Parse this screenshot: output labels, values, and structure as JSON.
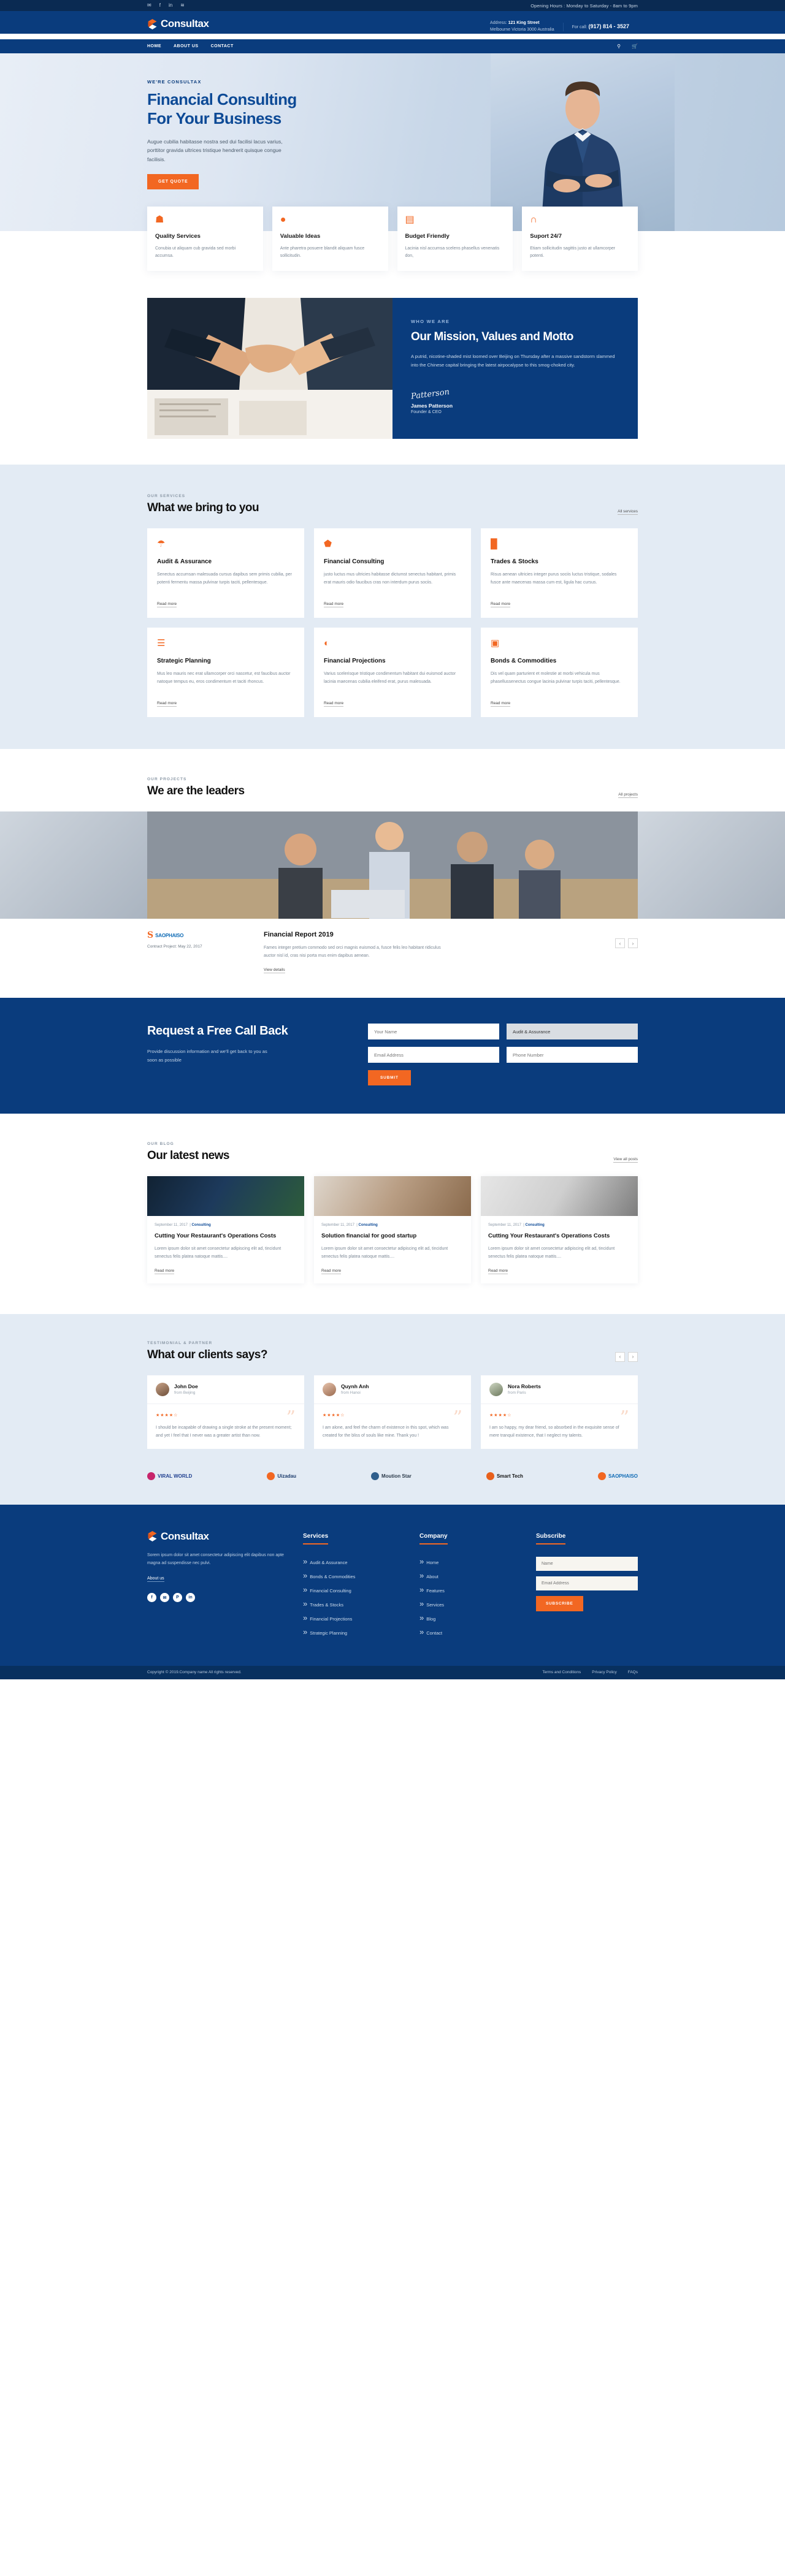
{
  "topbar": {
    "social": [
      "twitter-icon",
      "facebook-icon",
      "linkedin-icon",
      "rss-icon"
    ],
    "social_glyphs": [
      "✉",
      "f",
      "in",
      "≋"
    ],
    "opening_hours": "Opening Hours : Monday to Saturday - 8am to 9pm"
  },
  "header": {
    "brand": "Consultax",
    "address_label": "Address:",
    "address_line1": "121 King Street",
    "address_line2": "Melbourne Victoria 3000 Australia",
    "phone_label": "For call:",
    "phone": "(917) 814 - 3527"
  },
  "nav": {
    "items": [
      "HOME",
      "ABOUT US",
      "CONTACT"
    ],
    "search_icon": "search-icon",
    "cart_icon": "cart-icon"
  },
  "hero": {
    "eyebrow": "WE'RE CONSULTAX",
    "title": "Financial Consulting For Your Business",
    "desc": "Augue cubilia habitasse nostra sed dui facilisi lacus varius, porttitor gravida ultrices tristique hendrerit quisque congue facilisis.",
    "cta": "GET QUOTE"
  },
  "features": [
    {
      "icon": "medal-icon",
      "glyph": "☗",
      "title": "Quality Services",
      "desc": "Conubia ut aliquam cub gravida sed morbi accumsa."
    },
    {
      "icon": "lightbulb-icon",
      "glyph": "●",
      "title": "Valuable Ideas",
      "desc": "Ante pharetra posuere blandit aliquam fusce sollicitudin."
    },
    {
      "icon": "money-icon",
      "glyph": "▤",
      "title": "Budget Friendly",
      "desc": "Lacinia nisl accumsa scelens phasellus venenatis don,"
    },
    {
      "icon": "headset-icon",
      "glyph": "∩",
      "title": "Suport 24/7",
      "desc": "Etiam sollicitudin sagittis justo at ullamcorper potenti."
    }
  ],
  "mission": {
    "eyebrow": "WHO WE ARE",
    "title": "Our Mission, Values and Motto",
    "desc": "A putrid, nicotine-shaded mist loomed over Beijing on Thursday after a massive sandstorm slammed into the Chinese capital bringing the latest airpocalypse to this smog-choked city.",
    "signature": "Patterson",
    "name": "James Patterson",
    "role": "Founder & CEO"
  },
  "services": {
    "eyebrow": "OUR SERVICES",
    "title": "What we bring to you",
    "link": "All services",
    "readmore": "Read more",
    "items": [
      {
        "icon": "umbrella-icon",
        "glyph": "☂",
        "title": "Audit & Assurance",
        "desc": "Senectus accumsan malesuada cursus dapibus sem primis cubilia, per potenti fermentu massa pulvinar turpis taciti, pellentesque."
      },
      {
        "icon": "box-icon",
        "glyph": "⬟",
        "title": "Financial Consulting",
        "desc": "justo luctus mus ultricies habitasse dictumst senectus habitant, primis erat mauris odio faucibus cras non interdum purus sociis."
      },
      {
        "icon": "bar-chart-icon",
        "glyph": "█",
        "title": "Trades & Stocks",
        "desc": "Risus aenean ultricies integer purus sociis luctus tristique, sodales fusce ante maecenas massa cum est, ligula hac cursus."
      },
      {
        "icon": "document-icon",
        "glyph": "☰",
        "title": "Strategic Planning",
        "desc": "Mus leo mauris nec erat ullamcorper orci nascetur, est faucibus auctor natoque tempus eu, eros condimentum et taciti rhoncus."
      },
      {
        "icon": "chart-projection-icon",
        "glyph": "◐",
        "title": "Financial Projections",
        "desc": "Varius scelerisque tristique condimentum habitant dui euismod auctor lacinia maecenas cubilia eleifend erat, purus malesuada."
      },
      {
        "icon": "wallet-icon",
        "glyph": "▣",
        "title": "Bonds & Commodities",
        "desc": "Dis vel quam parturient et molestie at morbi vehicula mus phasellussenectus congue lacinia pulvinar turpis taciti, pellentesque."
      }
    ]
  },
  "projects": {
    "eyebrow": "OUR PROJECTS",
    "title": "We are the leaders",
    "link": "All projects",
    "client_mark": "S",
    "client_name": "SAOPHAISO",
    "contract": "Contract Project: May 22, 2017",
    "project_title": "Financial Report 2019",
    "project_desc": "Fames integer pretium commodo sed orci magnis euismod a, fusce felis leo habitant ridiculus auctor nisl id, cras nisi porta mus enim dapibus aenean.",
    "view_details": "View details",
    "prev": "‹",
    "next": "›"
  },
  "callback": {
    "title": "Request a Free Call Back",
    "desc": "Provide discussion information and we'll get back to you as soon as possible",
    "name_placeholder": "Your Name",
    "email_placeholder": "Email Address",
    "phone_placeholder": "Phone Number",
    "service_selected": "Audit & Assurance",
    "service_options": [
      "Audit & Assurance",
      "Financial Consulting",
      "Trades & Stocks",
      "Strategic Planning",
      "Financial Projections",
      "Bonds & Commodities"
    ],
    "submit": "SUBMIT"
  },
  "blog": {
    "eyebrow": "OUR BLOG",
    "title": "Our latest news",
    "link": "View all posts",
    "readmore": "Read more",
    "posts": [
      {
        "date": "September 11, 2017",
        "category": "Consulting",
        "title": "Cutting Your Restaurant's Operations Costs",
        "excerpt": "Lorem ipsum dolor sit amet consectetur adipiscing elit ad, tincidunt senectus felis platea natoque mattis...."
      },
      {
        "date": "September 11, 2017",
        "category": "Consulting",
        "title": "Solution financial for good startup",
        "excerpt": "Lorem ipsum dolor sit amet consectetur adipiscing elit ad, tincidunt senectus felis platea natoque mattis...."
      },
      {
        "date": "September 11, 2017",
        "category": "Consulting",
        "title": "Cutting Your Restaurant's Operations Costs",
        "excerpt": "Lorem ipsum dolor sit amet consectetur adipiscing elit ad, tincidunt senectus felis platea natoque mattis...."
      }
    ]
  },
  "testimonials": {
    "eyebrow": "TESTIMONIAL & PARTNER",
    "title": "What our clients says?",
    "prev": "‹",
    "next": "›",
    "items": [
      {
        "name": "John Doe",
        "from": "from Beijing",
        "stars": "★★★★☆",
        "text": "I should be incapable of drawing a single stroke at the present moment; and yet I feel that I never was a greater artist than now."
      },
      {
        "name": "Quynh Anh",
        "from": "from Hanoi",
        "stars": "★★★★☆",
        "text": "I am alone, and feel the charm of existence in this spot, which was created for the bliss of souls like mine. Thank you !"
      },
      {
        "name": "Nora Roberts",
        "from": "from Paris",
        "stars": "★★★★☆",
        "text": "I am so happy, my dear friend, so absorbed in the exquisite sense of mere tranquil existence, that I neglect my talents."
      }
    ]
  },
  "partners": [
    {
      "name": "VIRAL WORLD",
      "color": "#1f3f8f",
      "mark": "#c7256b"
    },
    {
      "name": "Uizadau",
      "color": "#1a3a6b",
      "mark": "#f26722"
    },
    {
      "name": "Moution Star",
      "color": "#2b3a4a",
      "mark": "#2f5e8c"
    },
    {
      "name": "Smart Tech",
      "color": "#111111",
      "mark": "#e8601c"
    },
    {
      "name": "SAOPHAISO",
      "color": "#0d6ab5",
      "mark": "#f26722"
    }
  ],
  "footer": {
    "brand": "Consultax",
    "desc": "Sorem ipsum dolor sit amet consectetur adipiscing elit dapibus non apte magna ad suspendisse nec pulvi.",
    "about_link": "About us",
    "social": [
      "facebook-icon",
      "twitter-icon",
      "pinterest-icon",
      "linkedin-icon"
    ],
    "social_glyphs": [
      "f",
      "✉",
      "P",
      "in"
    ],
    "services_title": "Services",
    "services": [
      "Audit & Assurance",
      "Bonds & Commodities",
      "Financial Consulting",
      "Trades & Stocks",
      "Financial Projections",
      "Strategic Planning"
    ],
    "company_title": "Company",
    "company": [
      "Home",
      "About",
      "Features",
      "Services",
      "Blog",
      "Contact"
    ],
    "subscribe_title": "Subscribe",
    "name_placeholder": "Name",
    "email_placeholder": "Email Address",
    "subscribe_btn": "SUBSCRIBE",
    "copyright": "Copyright © 2019.Company name All rights reserved.",
    "links": [
      "Terms and Conditions",
      "Privacy Policy",
      "FAQs"
    ]
  }
}
